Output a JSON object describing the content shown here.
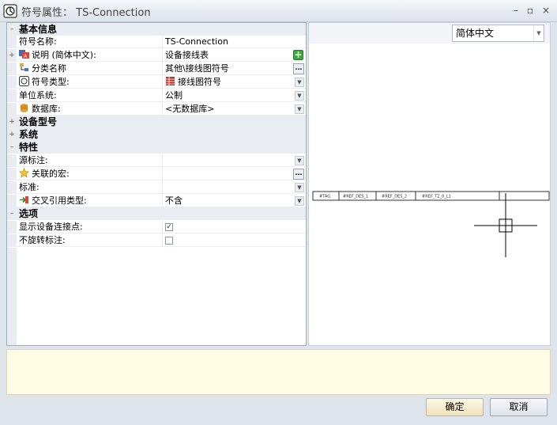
{
  "window": {
    "title": "符号属性： TS-Connection",
    "minimize": "–",
    "restore": "▫",
    "close": "×"
  },
  "properties": {
    "basic_info": {
      "label": "基本信息",
      "symbol_name": {
        "label": "符号名称:",
        "value": "TS-Connection"
      },
      "description": {
        "label": "说明 (简体中文):",
        "value": "设备接线表"
      },
      "category": {
        "label": "分类名称",
        "value": "其他\\接线图符号"
      },
      "symbol_type": {
        "label": "符号类型:",
        "value": "接线图符号"
      },
      "unit_system": {
        "label": "单位系统:",
        "value": "公制"
      },
      "database": {
        "label": "数据库:",
        "value": "<无数据库>"
      }
    },
    "device_model": {
      "label": "设备型号"
    },
    "system": {
      "label": "系统"
    },
    "characteristics": {
      "label": "特性",
      "source_tag": {
        "label": "源标注:",
        "value": ""
      },
      "associated_macro": {
        "label": "关联的宏:",
        "value": ""
      },
      "standard": {
        "label": "标准:",
        "value": ""
      },
      "cross_ref_type": {
        "label": "交叉引用类型:",
        "value": "不含"
      }
    },
    "options": {
      "label": "选项",
      "show_device_points": {
        "label": "显示设备连接点:",
        "checked": true
      },
      "no_rotate_tag": {
        "label": "不旋转标注:",
        "checked": false
      }
    }
  },
  "preview": {
    "language": "简体中文",
    "cells": [
      "#TAG",
      "#REF_DES_1",
      "#REF_DES_2",
      "#REF_TZ_0_L1"
    ]
  },
  "buttons": {
    "ok": "确定",
    "cancel": "取消"
  },
  "colors": {
    "info_bg": "#fefde4",
    "plus_green": "#3aaa3a"
  }
}
